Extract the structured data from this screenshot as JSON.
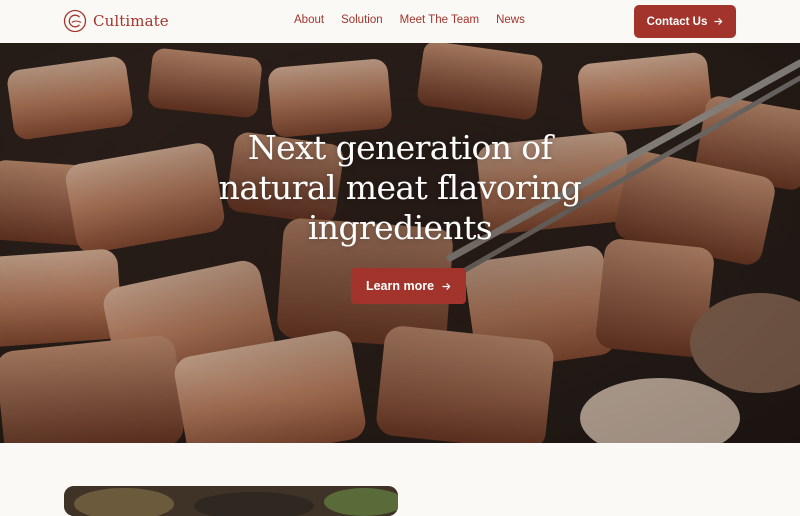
{
  "brand": {
    "name": "Cultimate"
  },
  "nav": {
    "items": [
      {
        "label": "About"
      },
      {
        "label": "Solution"
      },
      {
        "label": "Meet The Team"
      },
      {
        "label": "News"
      }
    ]
  },
  "header": {
    "contact_label": "Contact Us"
  },
  "hero": {
    "title_lines": [
      "Next generation of",
      "natural meat flavoring",
      "ingredients"
    ],
    "cta_label": "Learn more"
  },
  "colors": {
    "accent": "#a2342b",
    "background": "#fbf9f6"
  },
  "icons": {
    "logo": "cultimate-logo-icon",
    "cta_arrow": "arrow-right-icon"
  }
}
